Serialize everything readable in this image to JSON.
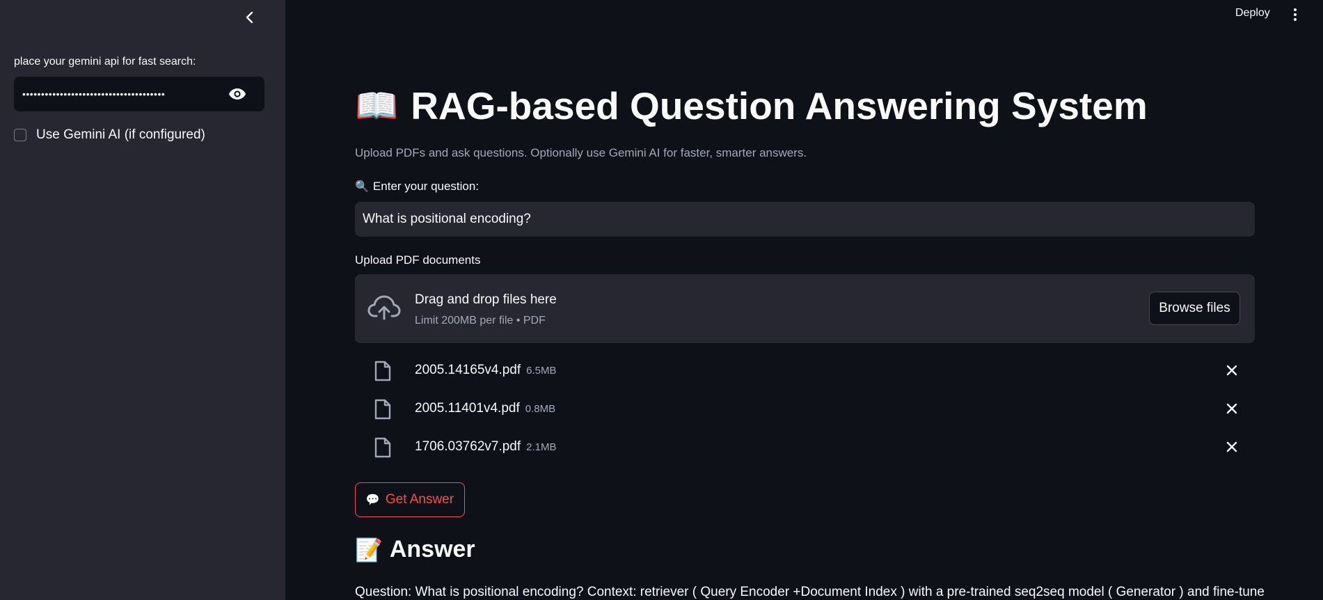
{
  "sidebar": {
    "api_label": "place your gemini api for fast search:",
    "api_value": "••••••••••••••••••••••••••••••••••••••",
    "use_gemini_label": "Use Gemini AI (if configured)",
    "use_gemini_checked": false,
    "collapse_icon": "chevron-left-icon",
    "eye_icon": "eye-icon"
  },
  "header": {
    "deploy_label": "Deploy",
    "menu_icon": "vertical-dots-icon"
  },
  "main": {
    "title_emoji": "📖",
    "title": "RAG-based Question Answering System",
    "subtitle": "Upload PDFs and ask questions. Optionally use Gemini AI for faster, smarter answers.",
    "question_label_emoji": "🔍",
    "question_label": "Enter your question:",
    "question_value": "What is positional encoding?",
    "upload_label": "Upload PDF documents",
    "dropzone": {
      "title": "Drag and drop files here",
      "subtitle": "Limit 200MB per file • PDF",
      "browse_label": "Browse files",
      "icon": "cloud-upload-icon"
    },
    "files": [
      {
        "name": "2005.14165v4.pdf",
        "size": "6.5MB"
      },
      {
        "name": "2005.11401v4.pdf",
        "size": "0.8MB"
      },
      {
        "name": "1706.03762v7.pdf",
        "size": "2.1MB"
      }
    ],
    "get_answer_emoji": "💬",
    "get_answer_label": "Get Answer",
    "answer_emoji": "📝",
    "answer_heading": "Answer",
    "answer_text": "Question: What is positional encoding? Context: retriever ( Query Encoder +Document Index ) with a pre-trained seq2seq model ( Generator ) and fine-tune"
  },
  "colors": {
    "background": "#0e1117",
    "sidebar": "#262730",
    "accent": "#ff4b4b",
    "muted_text": "#a3a8b8"
  }
}
